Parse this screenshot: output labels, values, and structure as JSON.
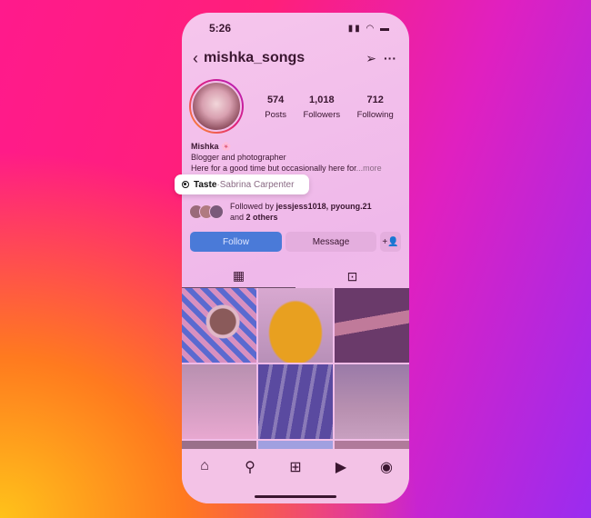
{
  "status": {
    "time": "5:26"
  },
  "header": {
    "username": "mishka_songs"
  },
  "stats": [
    {
      "value": "574",
      "label": "Posts"
    },
    {
      "value": "1,018",
      "label": "Followers"
    },
    {
      "value": "712",
      "label": "Following"
    }
  ],
  "bio": {
    "name": "Mishka",
    "emoji": "🌸",
    "line1": "Blogger and photographer",
    "line2": "Here for a good time but occasionally here for",
    "more": "...more"
  },
  "taste": {
    "label": "Taste",
    "separator": " · ",
    "artist": "Sabrina Carpenter"
  },
  "followed": {
    "prefix": "Followed by ",
    "names": "jessjess1018, pyoung.21",
    "and": "and ",
    "others": "2 others"
  },
  "buttons": {
    "follow": "Follow",
    "message": "Message"
  },
  "colors": {
    "follow": "#4a7ad8",
    "accent_gradient": [
      "#ff1a8c",
      "#9a2cf0",
      "#ffc21a"
    ]
  }
}
